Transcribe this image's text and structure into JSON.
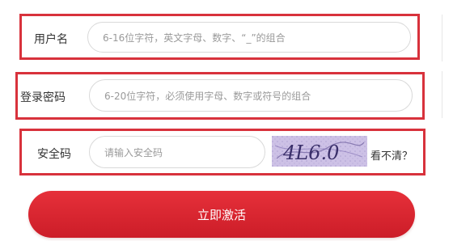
{
  "form": {
    "username": {
      "label": "用户名",
      "placeholder": "6-16位字符，英文字母、数字、“_”的组合"
    },
    "password": {
      "label": "登录密码",
      "placeholder": "6-20位字符，必须使用字母、数字或符号的组合"
    },
    "security_code": {
      "label": "安全码",
      "placeholder": "请输入安全码",
      "captcha_text": "4L6.0",
      "refresh_label": "看不清？"
    },
    "submit_label": "立即激活"
  },
  "colors": {
    "highlight_border": "#d8323c",
    "button": "#d9232e",
    "captcha_bg": "#c9bde3"
  }
}
